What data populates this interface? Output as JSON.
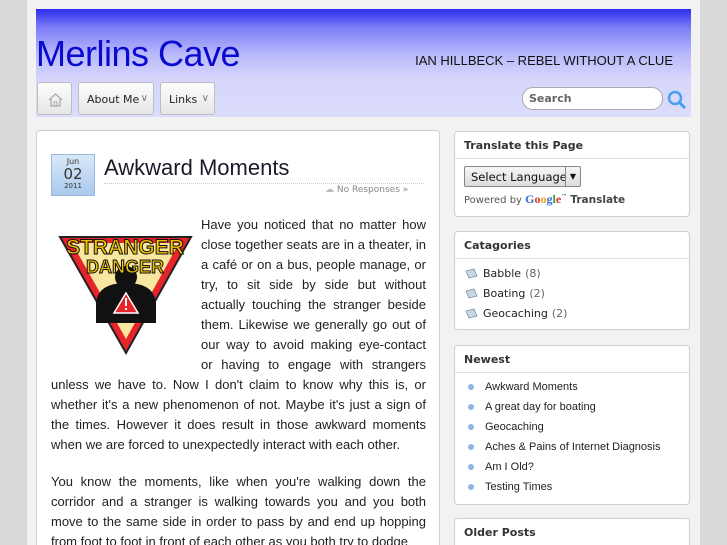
{
  "header": {
    "site_title": "Merlins Cave",
    "tagline": "IAN HILLBECK – REBEL WITHOUT A CLUE"
  },
  "nav": {
    "home_icon": "home-icon",
    "items": [
      {
        "label": "About Me",
        "icon": "chevron-down-icon"
      },
      {
        "label": "Links",
        "icon": "chevron-down-icon"
      }
    ],
    "search_placeholder": "Search"
  },
  "post": {
    "date": {
      "month": "Jun",
      "day": "02",
      "year": "2011"
    },
    "title": "Awkward Moments",
    "responses": "No Responses »",
    "image_text": "STRANGER DANGER",
    "paragraph1": "Have you noticed that no matter how close together seats are in a theater, in a café or on a bus, people manage, or try, to sit side by side but without actually touching the stranger beside them. Likewise we generally go out of our way to avoid making eye-contact or having to engage with strangers unless we have to. Now I don't claim to know why this is, or whether it's a new phenomenon of not. Maybe it's just a sign of the times. However it does result in those awkward moments when we are forced to unexpectedly interact with each other.",
    "paragraph2": "You know the moments, like when you're walking down the corridor and a stranger is walking towards you and you both move to the same side in order to pass by and end up hopping from foot to foot in front of each other as you both try to dodge"
  },
  "sidebar": {
    "translate": {
      "title": "Translate this Page",
      "select_value": "Select Language",
      "powered_by": "Powered by",
      "google": "Google",
      "tm": "™",
      "translate_word": "Translate"
    },
    "categories": {
      "title": "Catagories",
      "items": [
        {
          "label": "Babble",
          "count": "(8)"
        },
        {
          "label": "Boating",
          "count": "(2)"
        },
        {
          "label": "Geocaching",
          "count": "(2)"
        }
      ]
    },
    "newest": {
      "title": "Newest",
      "items": [
        {
          "label": "Awkward Moments"
        },
        {
          "label": "A great day for boating"
        },
        {
          "label": "Geocaching"
        },
        {
          "label": "Aches & Pains of Internet Diagnosis"
        },
        {
          "label": "Am I Old?"
        },
        {
          "label": "Testing Times"
        }
      ]
    },
    "older": {
      "title": "Older Posts"
    }
  },
  "colors": {
    "header_top": "#2c2cf0",
    "title": "#0b0bd0",
    "bullet": "#8fb4e6"
  }
}
